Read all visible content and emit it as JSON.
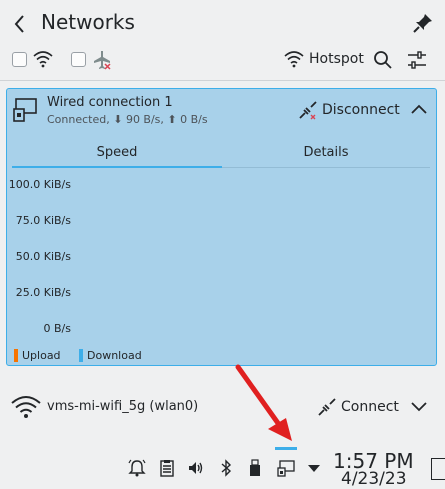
{
  "header": {
    "title": "Networks"
  },
  "toolbar": {
    "hotspot_label": "Hotspot"
  },
  "active_connection": {
    "name": "Wired connection 1",
    "status": "Connected, ⬇ 90 B/s, ⬆ 0 B/s",
    "action_label": "Disconnect",
    "tabs": [
      {
        "label": "Speed"
      },
      {
        "label": "Details"
      }
    ],
    "graph": {
      "y_labels": [
        "100.0 KiB/s",
        "75.0 KiB/s",
        "50.0 KiB/s",
        "25.0 KiB/s",
        "0 B/s"
      ],
      "legend": [
        {
          "label": "Upload",
          "color": "#f67400"
        },
        {
          "label": "Download",
          "color": "#3daee9"
        }
      ]
    }
  },
  "wifi_connection": {
    "name": "vms-mi-wifi_5g (wlan0)",
    "action_label": "Connect"
  },
  "taskbar": {
    "time": "1:57 PM",
    "date": "4/23/23",
    "icons": [
      "notifications-icon",
      "clipboard-icon",
      "volume-icon",
      "bluetooth-icon",
      "usb-drive-icon",
      "network-icon",
      "expand-arrow-icon"
    ]
  },
  "colors": {
    "accent": "#3daee9",
    "annotation_arrow": "#e02020"
  }
}
